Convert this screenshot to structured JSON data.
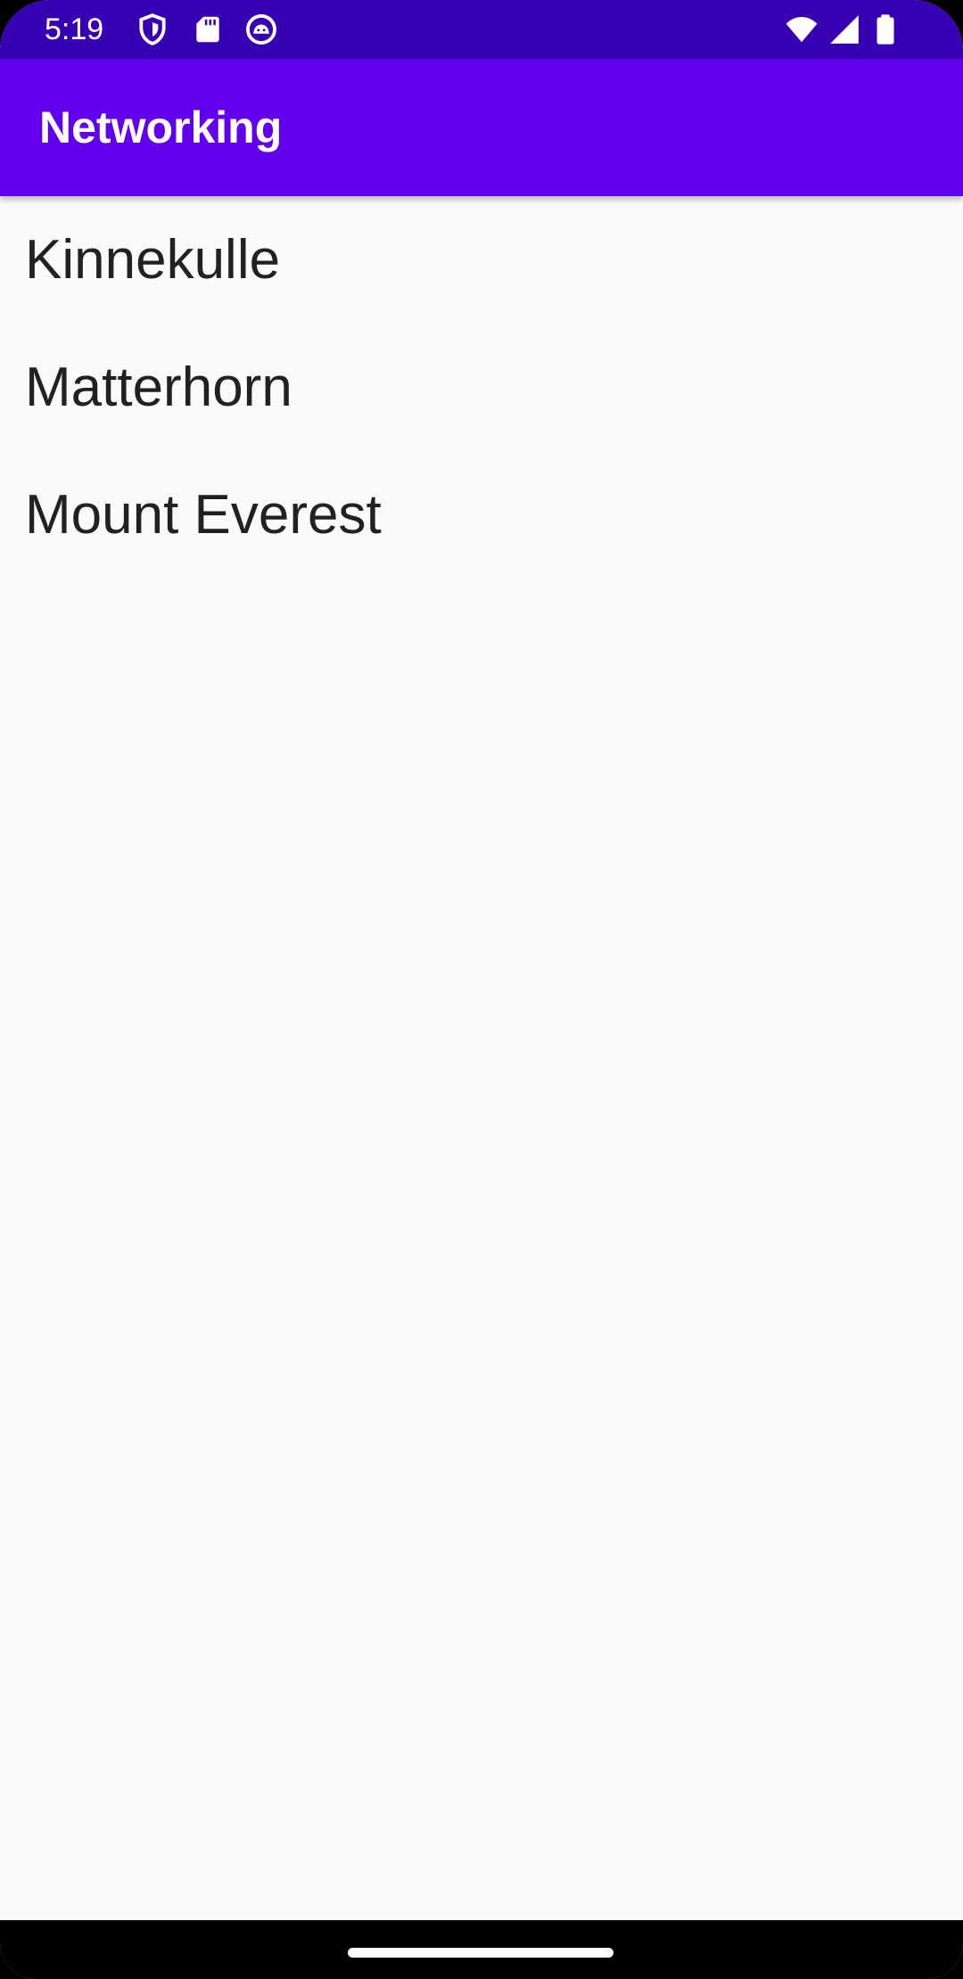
{
  "status_bar": {
    "time": "5:19",
    "color": "#3700B3",
    "left_icons": [
      "shield-icon",
      "sd-card-icon",
      "android-debug-icon"
    ],
    "right_icons": [
      "wifi-icon",
      "cell-signal-icon",
      "battery-icon"
    ]
  },
  "app_bar": {
    "title": "Networking",
    "color": "#6200EE"
  },
  "list": {
    "items": [
      {
        "label": "Kinnekulle"
      },
      {
        "label": "Matterhorn"
      },
      {
        "label": "Mount Everest"
      }
    ]
  }
}
